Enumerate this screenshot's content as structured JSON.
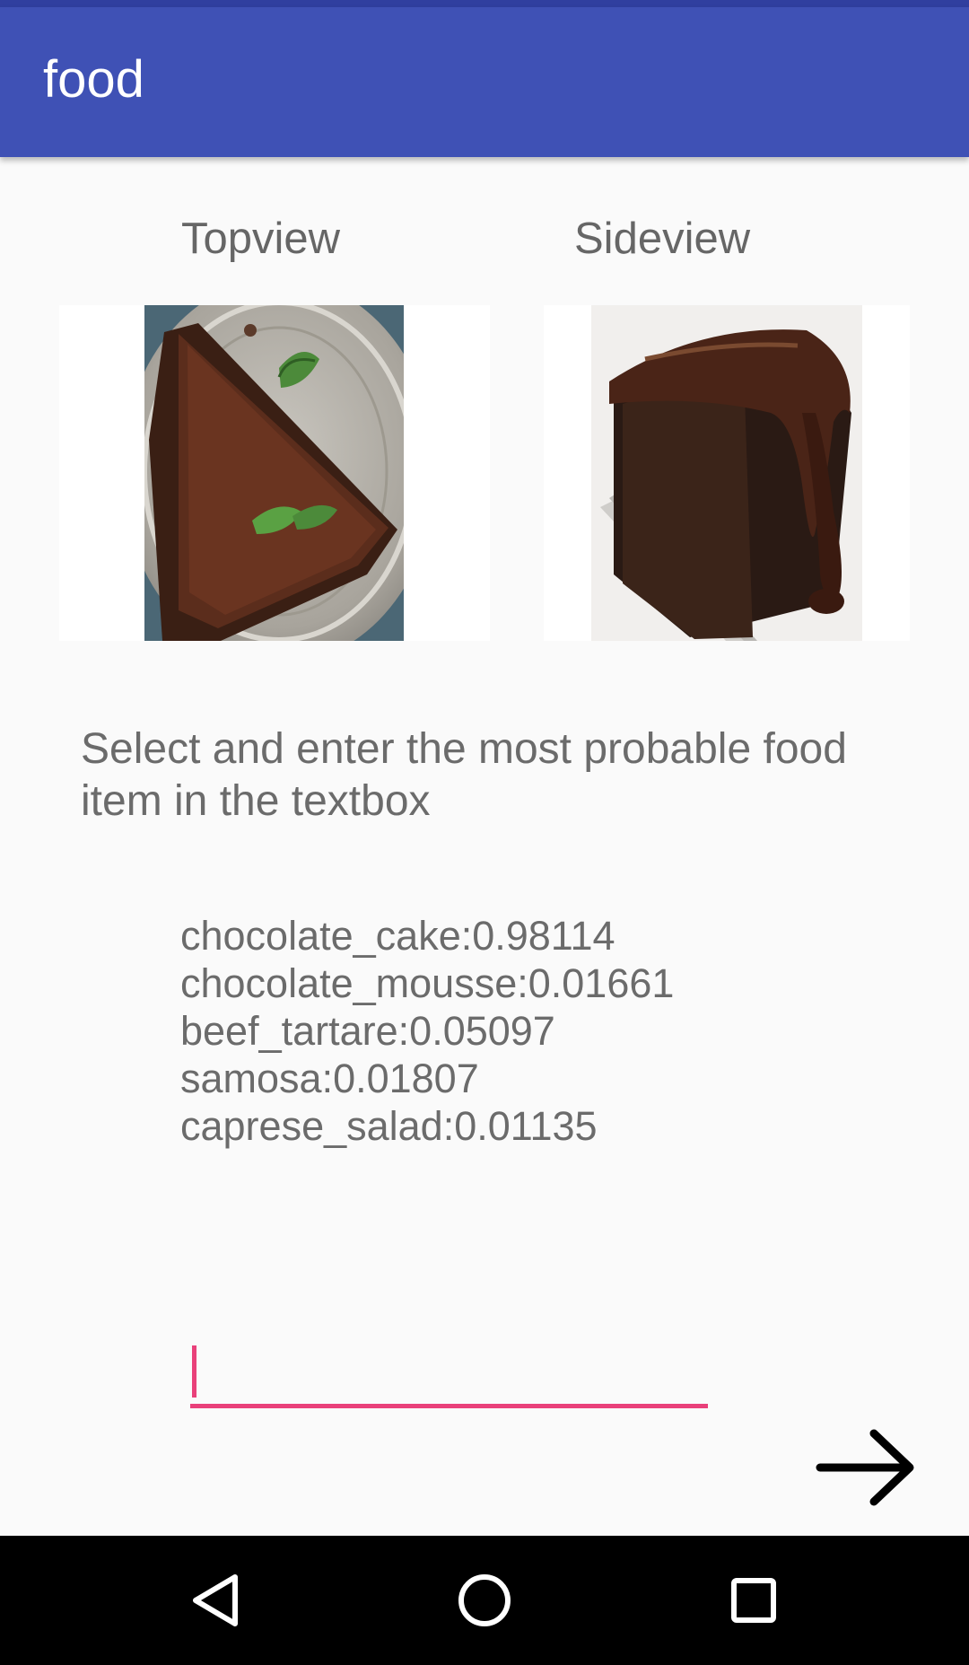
{
  "app_bar": {
    "title": "food",
    "color": "#3f51b5"
  },
  "views": {
    "top_label": "Topview",
    "side_label": "Sideview",
    "top_image_icon": "chocolate-cake-topview-photo",
    "side_image_icon": "chocolate-cake-sideview-photo"
  },
  "instruction": "Select and enter the most probable food item in the textbox",
  "predictions": [
    "chocolate_cake:0.98114",
    "chocolate_mousse:0.01661",
    "beef_tartare:0.05097",
    "samosa:0.01807",
    "caprese_salad:0.01135"
  ],
  "input": {
    "value": "",
    "placeholder": "",
    "accent": "#e9407a"
  },
  "next_icon": "arrow-right-icon",
  "nav": {
    "back_icon": "back-triangle-icon",
    "home_icon": "home-circle-icon",
    "recents_icon": "recents-square-icon"
  }
}
